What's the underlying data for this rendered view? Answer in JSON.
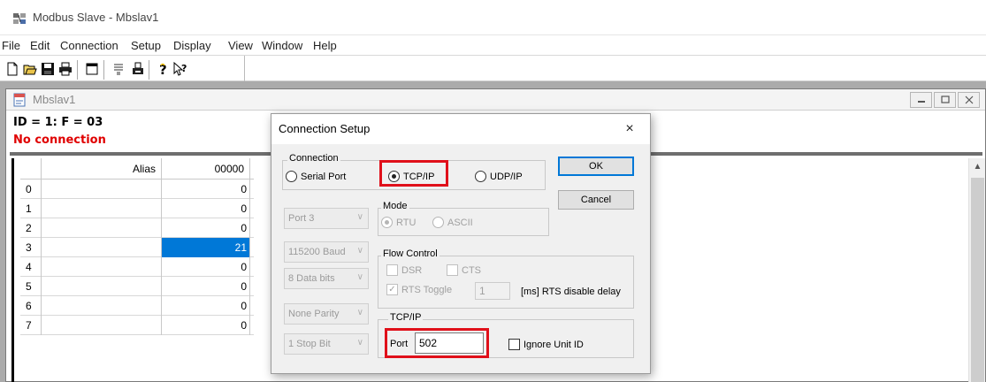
{
  "app": {
    "title": "Modbus Slave - Mbslav1",
    "menu": [
      "File",
      "Edit",
      "Connection",
      "Setup",
      "Display",
      "View",
      "Window",
      "Help"
    ],
    "toolbar_icons": [
      "new-icon",
      "open-icon",
      "save-icon",
      "print-icon",
      "window-icon",
      "log-icon",
      "print-preview-icon",
      "help-icon",
      "context-help-icon"
    ]
  },
  "child": {
    "title": "Mbslav1",
    "status_id": "ID = 1: F = 03",
    "status_connection": "No connection",
    "status_color": "#e00000",
    "grid": {
      "headers": [
        "Alias",
        "00000"
      ],
      "rows": [
        {
          "num": "0",
          "alias": "",
          "value": "0"
        },
        {
          "num": "1",
          "alias": "",
          "value": "0"
        },
        {
          "num": "2",
          "alias": "",
          "value": "0"
        },
        {
          "num": "3",
          "alias": "",
          "value": "21",
          "selected": true
        },
        {
          "num": "4",
          "alias": "",
          "value": "0"
        },
        {
          "num": "5",
          "alias": "",
          "value": "0"
        },
        {
          "num": "6",
          "alias": "",
          "value": "0"
        },
        {
          "num": "7",
          "alias": "",
          "value": "0"
        }
      ]
    }
  },
  "dialog": {
    "title": "Connection Setup",
    "close": "×",
    "connection_group": "Connection",
    "serial_port": "Serial Port",
    "tcp_ip": "TCP/IP",
    "udp_ip": "UDP/IP",
    "selected_connection": "TCP/IP",
    "ok": "OK",
    "cancel": "Cancel",
    "combos": [
      "Port 3",
      "115200 Baud",
      "8 Data bits",
      "None Parity",
      "1 Stop Bit"
    ],
    "mode_group": "Mode",
    "rtu": "RTU",
    "ascii": "ASCII",
    "flow_group": "Flow Control",
    "dsr": "DSR",
    "cts": "CTS",
    "rts_toggle": "RTS Toggle",
    "rts_value": "1",
    "rts_delay_label": "[ms] RTS disable delay",
    "tcp_group": "TCP/IP",
    "port_label": "Port",
    "port_value": "502",
    "ignore_unit_id": "Ignore Unit ID",
    "highlight_color": "#e0101a"
  }
}
